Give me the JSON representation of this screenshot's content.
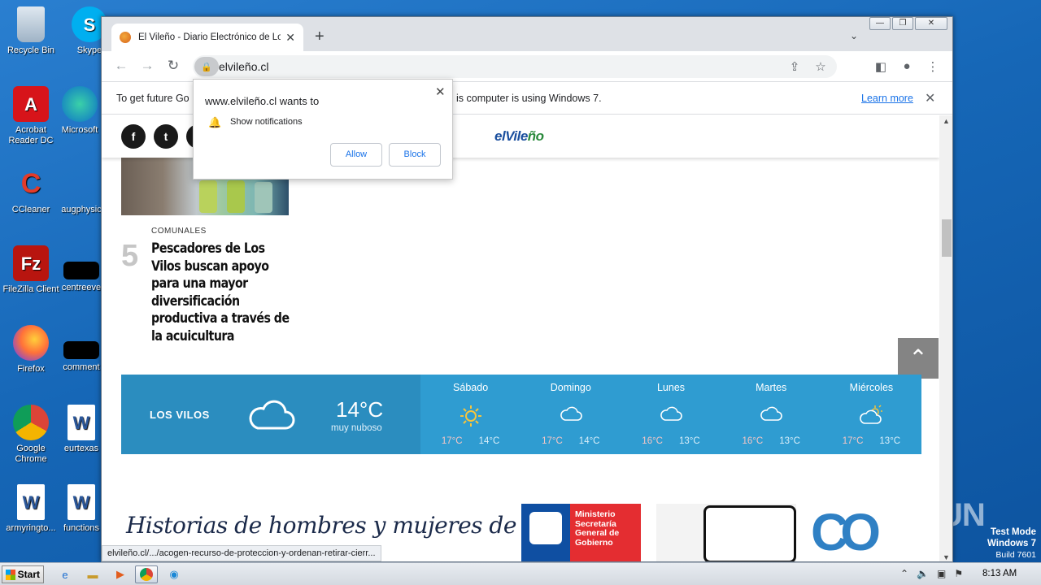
{
  "desktop": {
    "icons": [
      {
        "label": "Recycle Bin",
        "icon": "recycle-bin-icon"
      },
      {
        "label": "Skype",
        "icon": "skype-icon"
      },
      {
        "label": "Acrobat Reader DC",
        "icon": "acrobat-icon"
      },
      {
        "label": "Microsoft",
        "icon": "edge-icon"
      },
      {
        "label": "CCleaner",
        "icon": "ccleaner-icon"
      },
      {
        "label": "augphysic",
        "icon": "file-icon"
      },
      {
        "label": "FileZilla Client",
        "icon": "filezilla-icon"
      },
      {
        "label": "centreeve",
        "icon": "file-icon"
      },
      {
        "label": "Firefox",
        "icon": "firefox-icon"
      },
      {
        "label": "comment",
        "icon": "file-icon"
      },
      {
        "label": "Google Chrome",
        "icon": "chrome-icon"
      },
      {
        "label": "eurtexas",
        "icon": "word-icon"
      },
      {
        "label": "armyringto...",
        "icon": "word-icon"
      },
      {
        "label": "functions",
        "icon": "word-icon"
      }
    ]
  },
  "browser": {
    "tab_title": "El Vileño - Diario Electrónico de Los V",
    "url": "elvileño.cl",
    "infobar": {
      "message_left": "To get future Go",
      "message_right": "is computer is using Windows 7.",
      "learn_more": "Learn more"
    },
    "status_url": "elvileño.cl/.../acogen-recurso-de-proteccion-y-ordenan-retirar-cierr..."
  },
  "popup": {
    "site": "www.elvileño.cl wants to",
    "permission": "Show notifications",
    "allow": "Allow",
    "block": "Block"
  },
  "page": {
    "logo_a": "elVile",
    "logo_b": "ño",
    "article": {
      "category": "COMUNALES",
      "number": "5",
      "title": "Pescadores de Los Vilos buscan apoyo para una mayor diversificación productiva a través de la acuicultura"
    },
    "weather": {
      "city": "LOS VILOS",
      "temp": "14°C",
      "condition": "muy nuboso",
      "days": [
        {
          "name": "Sábado",
          "hi": "17°C",
          "lo": "14°C",
          "icon": "sun-icon"
        },
        {
          "name": "Domingo",
          "hi": "17°C",
          "lo": "14°C",
          "icon": "cloud-icon"
        },
        {
          "name": "Lunes",
          "hi": "16°C",
          "lo": "13°C",
          "icon": "cloud-icon"
        },
        {
          "name": "Martes",
          "hi": "16°C",
          "lo": "13°C",
          "icon": "cloud-icon"
        },
        {
          "name": "Miércoles",
          "hi": "17°C",
          "lo": "13°C",
          "icon": "sun-cloud-icon"
        }
      ]
    },
    "banner": {
      "script_text": "Historias de hombres y mujeres de mar",
      "ministry": "Ministerio Secretaría General de Gobierno"
    }
  },
  "overlay": {
    "watermark": "ANY.RUN",
    "test_mode": "Test Mode",
    "os": "Windows 7",
    "build": "Build 7601"
  },
  "taskbar": {
    "start": "Start",
    "clock": "8:13 AM"
  }
}
